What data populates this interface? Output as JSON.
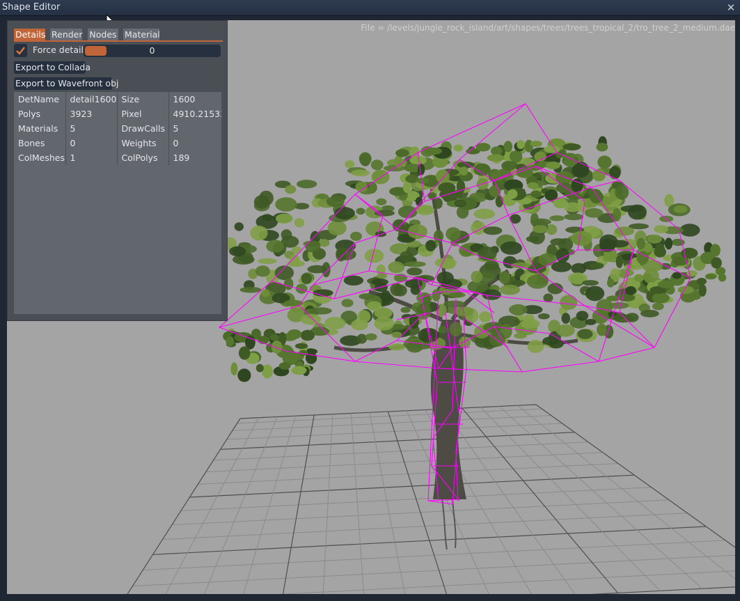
{
  "window": {
    "title": "Shape Editor",
    "close_icon": "close-icon"
  },
  "viewport": {
    "file_label": "File = /levels/jungle_rock_island/art/shapes/trees/trees_tropical_2/tro_tree_2_medium.dae",
    "background": "#a4a4a4",
    "wireframe_color": "#ff00ff"
  },
  "panel": {
    "tabs": [
      {
        "label": "Details",
        "active": true
      },
      {
        "label": "Render",
        "active": false
      },
      {
        "label": "Nodes",
        "active": false
      },
      {
        "label": "Material",
        "active": false
      }
    ],
    "force_detail": {
      "label": "Force detail",
      "checked": true
    },
    "detail_slider": {
      "value": "0",
      "fill_fraction": 0.16
    },
    "export_collada_label": "Export to Collada",
    "export_wavefront_label": "Export to Wavefront obj",
    "info_rows": [
      [
        "DetName",
        "detail1600",
        "Size",
        "1600"
      ],
      [
        "Polys",
        "3923",
        "Pixel",
        "4910.215332"
      ],
      [
        "Materials",
        "5",
        "DrawCalls",
        "5"
      ],
      [
        "Bones",
        "0",
        "Weights",
        "0"
      ],
      [
        "ColMeshes",
        "1",
        "ColPolys",
        "189"
      ]
    ]
  },
  "colors": {
    "accent": "#c0643a",
    "titlebar": "#2a3648",
    "panel": "#4a4e55"
  }
}
